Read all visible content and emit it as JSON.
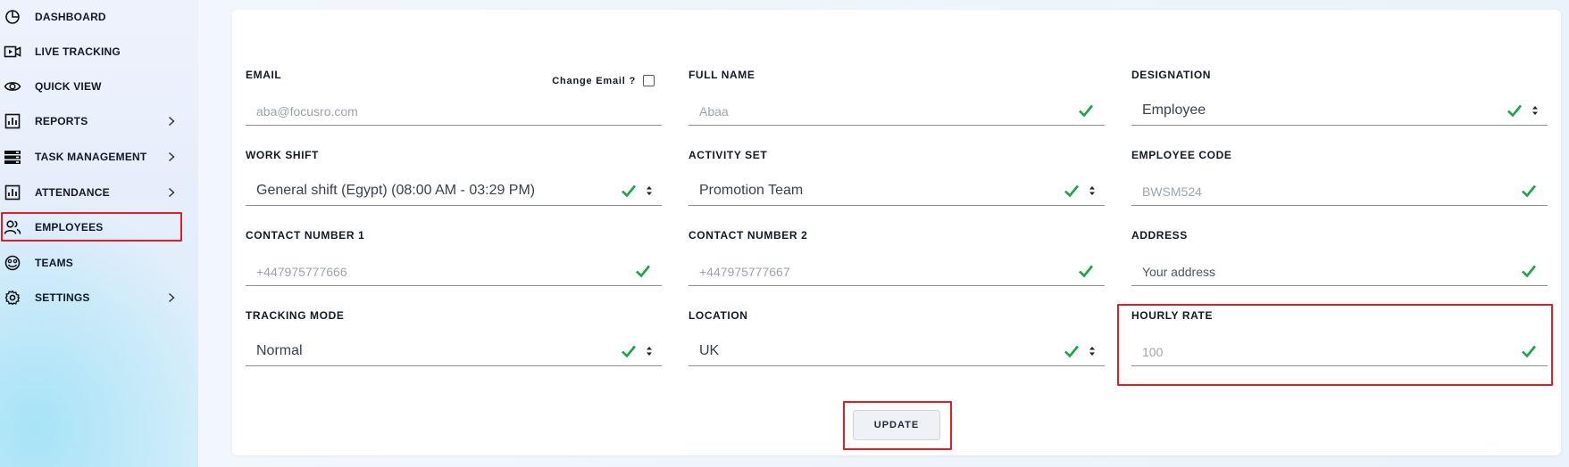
{
  "sidebar": {
    "items": [
      {
        "label": "DASHBOARD",
        "icon": "dashboard-pie-icon",
        "has_submenu": false
      },
      {
        "label": "LIVE TRACKING",
        "icon": "video-camera-icon",
        "has_submenu": false
      },
      {
        "label": "QUICK VIEW",
        "icon": "eye-icon",
        "has_submenu": false
      },
      {
        "label": "REPORTS",
        "icon": "reports-chart-icon",
        "has_submenu": true
      },
      {
        "label": "TASK MANAGEMENT",
        "icon": "server-stack-icon",
        "has_submenu": true
      },
      {
        "label": "ATTENDANCE",
        "icon": "attendance-chart-icon",
        "has_submenu": true
      },
      {
        "label": "EMPLOYEES",
        "icon": "users-icon",
        "has_submenu": false,
        "active": true
      },
      {
        "label": "TEAMS",
        "icon": "team-smile-icon",
        "has_submenu": false
      },
      {
        "label": "SETTINGS",
        "icon": "gear-icon",
        "has_submenu": true
      }
    ]
  },
  "form": {
    "email": {
      "label": "EMAIL",
      "value": "aba@focusro.com",
      "change_email_label": "Change Email ?",
      "change_email_checked": false
    },
    "full_name": {
      "label": "FULL NAME",
      "value": "Abaa"
    },
    "designation": {
      "label": "DESIGNATION",
      "value": "Employee"
    },
    "work_shift": {
      "label": "WORK SHIFT",
      "value": "General shift (Egypt) (08:00 AM - 03:29 PM)"
    },
    "activity_set": {
      "label": "ACTIVITY SET",
      "value": "Promotion Team"
    },
    "employee_code": {
      "label": "EMPLOYEE CODE",
      "value": "BWSM524"
    },
    "contact_1": {
      "label": "CONTACT NUMBER 1",
      "value": "+447975777666"
    },
    "contact_2": {
      "label": "CONTACT NUMBER 2",
      "value": "+447975777667"
    },
    "address": {
      "label": "ADDRESS",
      "placeholder": "Your address"
    },
    "tracking_mode": {
      "label": "TRACKING MODE",
      "value": "Normal"
    },
    "location": {
      "label": "LOCATION",
      "value": "UK"
    },
    "hourly_rate": {
      "label": "HOURLY RATE",
      "value": "100"
    },
    "update_label": "UPDATE"
  },
  "colors": {
    "valid_check": "#1aa34a",
    "highlight": "#e11d2a"
  }
}
